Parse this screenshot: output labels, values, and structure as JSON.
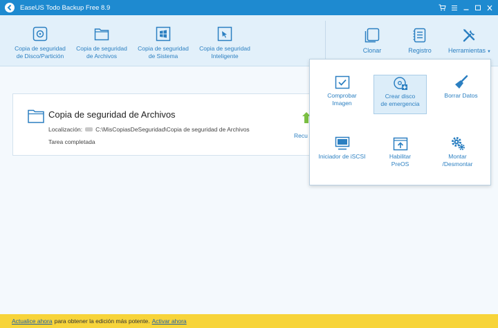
{
  "window": {
    "title": "EaseUS Todo Backup Free 8.9"
  },
  "toolbar": {
    "left_items": [
      {
        "line1": "Copia de seguridad",
        "line2": "de Disco/Partición",
        "icon": "disk-backup-icon"
      },
      {
        "line1": "Copia de seguridad",
        "line2": "de Archivos",
        "icon": "folder-icon"
      },
      {
        "line1": "Copia de seguridad",
        "line2": "de Sistema",
        "icon": "windows-icon"
      },
      {
        "line1": "Copia de seguridad",
        "line2": "Inteligente",
        "icon": "cursor-icon"
      }
    ],
    "right_items": [
      {
        "label": "Clonar",
        "icon": "clone-icon"
      },
      {
        "label": "Registro",
        "icon": "log-icon"
      },
      {
        "label": "Herramientas",
        "icon": "tools-icon"
      }
    ]
  },
  "task": {
    "title": "Copia de seguridad de Archivos",
    "location_label": "Localización:",
    "location_path": "C:\\MisCopiasDeSeguridad\\Copia de seguridad de Archivos",
    "status": "Tarea completada",
    "recover_label": "Recu"
  },
  "tools_menu": {
    "items": [
      {
        "line1": "Comprobar",
        "line2": "Imagen",
        "icon": "check-image-icon"
      },
      {
        "line1": "Crear disco",
        "line2": "de emergencia",
        "icon": "emergency-disk-icon"
      },
      {
        "line1": "Borrar Datos",
        "line2": "",
        "icon": "brush-icon"
      },
      {
        "line1": "Iniciador de iSCSI",
        "line2": "",
        "icon": "monitor-icon"
      },
      {
        "line1": "Habilitar",
        "line2": "PreOS",
        "icon": "preos-icon"
      },
      {
        "line1": "Montar",
        "line2": "/Desmontar",
        "icon": "gear-icon"
      }
    ]
  },
  "bottom": {
    "update_link": "Actualice ahora",
    "message": "para obtener la edición más potente.",
    "activate_link": "Activar ahora"
  },
  "colors": {
    "titlebar": "#1e8ad0",
    "accent": "#2b7fc1",
    "bottombar": "#f7d43a"
  }
}
